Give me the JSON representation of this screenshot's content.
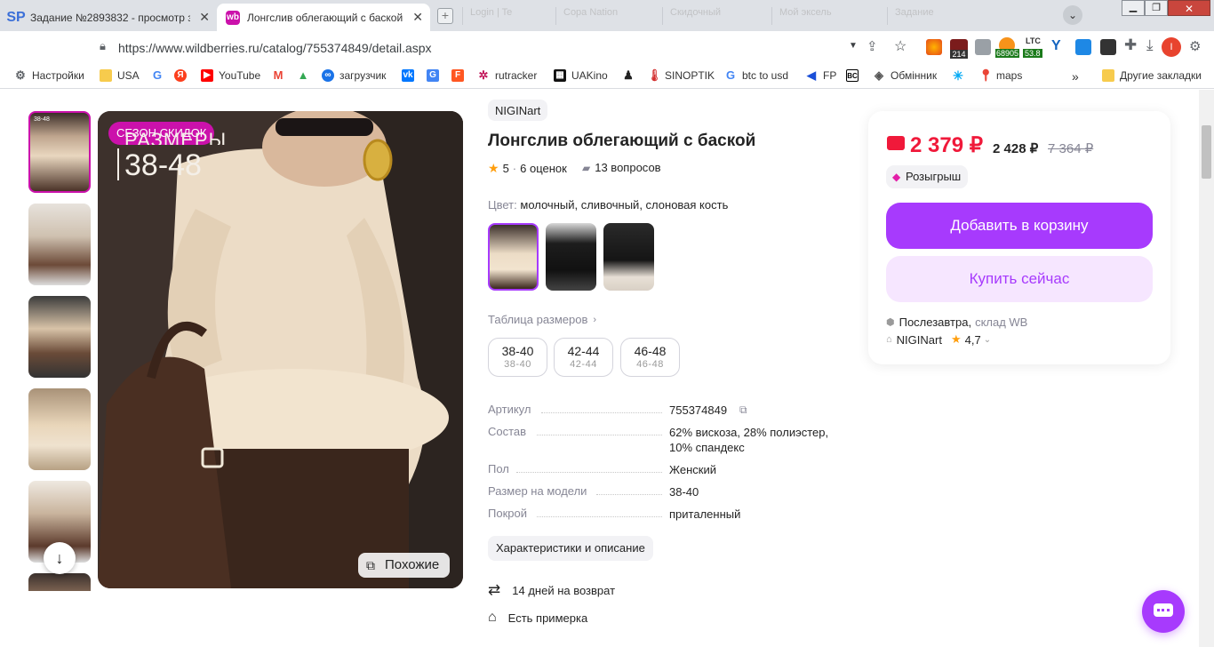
{
  "browser": {
    "tabs": [
      {
        "title": "Задание №2893832 - просмотр з",
        "favicon": "SP"
      },
      {
        "title": "Лонгслив облегающий с баской",
        "favicon": "wb"
      }
    ],
    "ghost_tabs": [
      "Login | Te",
      "Copa Nation",
      "Скидочный",
      "Мой эксель",
      "Задание"
    ],
    "url": "https://www.wildberries.ru/catalog/755374849/detail.aspx",
    "extensions": {
      "badge1": "214",
      "btc_price": "68905",
      "ltc_label": "LTC",
      "ltc_value": "53.8",
      "profile_letter": "I"
    },
    "bookmarks": [
      {
        "label": "Настройки",
        "icon": "gear-icon"
      },
      {
        "label": "USA",
        "icon": "folder-icon"
      },
      {
        "label": "",
        "icon": "google-icon"
      },
      {
        "label": "",
        "icon": "yandex-icon"
      },
      {
        "label": "YouTube",
        "icon": "youtube-icon"
      },
      {
        "label": "",
        "icon": "gmail-icon"
      },
      {
        "label": "",
        "icon": "drive-icon"
      },
      {
        "label": "загрузчик",
        "icon": "loop-icon"
      },
      {
        "label": "",
        "icon": "vk-icon"
      },
      {
        "label": "",
        "icon": "translate-icon"
      },
      {
        "label": "",
        "icon": "f-icon"
      },
      {
        "label": "rutracker",
        "icon": "rutracker-icon"
      },
      {
        "label": "UAKino",
        "icon": "film-icon"
      },
      {
        "label": "",
        "icon": "person-icon"
      },
      {
        "label": "SINOPTIK",
        "icon": "thermometer-icon"
      },
      {
        "label": "btc to usd",
        "icon": "google-icon"
      },
      {
        "label": "FP",
        "icon": "arrow-icon"
      },
      {
        "label": "",
        "icon": "bc-icon"
      },
      {
        "label": "Обмінник",
        "icon": "diamond-icon"
      },
      {
        "label": "",
        "icon": "star-icon"
      },
      {
        "label": "maps",
        "icon": "map-pin-icon"
      }
    ],
    "more_bookmarks": "»",
    "other_bookmarks": "Другие закладки"
  },
  "product": {
    "brand": "NIGINart",
    "title": "Лонгслив облегающий с баской",
    "rating": "5",
    "reviews": "6 оценок",
    "questions": "13 вопросов",
    "color_label": "Цвет:",
    "color_value": "молочный, сливочный, слоновая кость",
    "size_table_link": "Таблица размеров",
    "sizes": [
      {
        "main": "38-40",
        "sub": "38-40"
      },
      {
        "main": "42-44",
        "sub": "42-44"
      },
      {
        "main": "46-48",
        "sub": "46-48"
      }
    ],
    "specs": [
      {
        "key": "Артикул",
        "value": "755374849"
      },
      {
        "key": "Состав",
        "value": "62% вискоза, 28% полиэстер, 10% спандекс"
      },
      {
        "key": "Пол",
        "value": "Женский"
      },
      {
        "key": "Размер на модели",
        "value": "38-40"
      },
      {
        "key": "Покрой",
        "value": "приталенный"
      }
    ],
    "details_button": "Характеристики и описание",
    "return_policy": "14 дней на возврат",
    "fitting": "Есть примерка",
    "photo_badge": "СЕЗОН СКИДОК",
    "photo_overlay_small": "РАЗМЕРЫ",
    "photo_overlay_sizes": "38-48",
    "thumb_overlay": "38-48",
    "similar_button": "Похожие"
  },
  "buy_box": {
    "price": "2 379 ₽",
    "price_wallet": "2 428 ₽",
    "old_price": "7 364 ₽",
    "promo": "Розыгрыш",
    "add_to_cart": "Добавить в корзину",
    "buy_now": "Купить сейчас",
    "delivery": "Послезавтра,",
    "warehouse": "склад WB",
    "seller": "NIGINart",
    "seller_rating": "4,7"
  },
  "colors": {
    "accent": "#a73afd",
    "price": "#f0193a",
    "brand_pink": "#cb11ab"
  }
}
